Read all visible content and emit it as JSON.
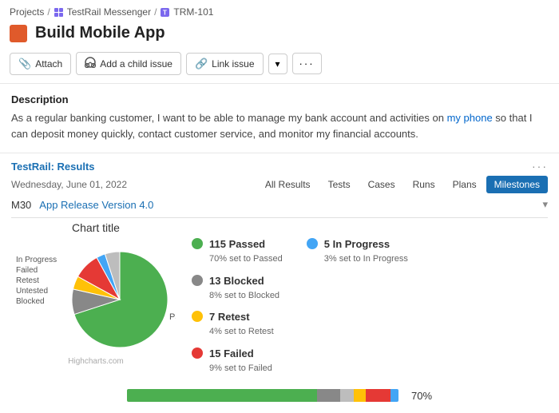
{
  "breadcrumb": {
    "projects": "Projects",
    "sep1": "/",
    "app": "TestRail Messenger",
    "sep2": "/",
    "issue": "TRM-101"
  },
  "header": {
    "title": "Build Mobile App"
  },
  "toolbar": {
    "attach_label": "Attach",
    "child_issue_label": "Add a child issue",
    "link_issue_label": "Link issue",
    "dropdown_label": "▾",
    "more_label": "···"
  },
  "description": {
    "title": "Description",
    "text_plain": "As a regular banking customer, I want to be able to manage my bank account and activities on ",
    "text_link": "my phone",
    "text_after": " so that I can deposit money quickly, contact customer service, and monitor my financial accounts."
  },
  "testrail": {
    "title": "TestRail: Results",
    "date": "Wednesday, June 01, 2022",
    "dots": "···",
    "tabs": [
      "All Results",
      "Tests",
      "Cases",
      "Runs",
      "Plans",
      "Milestones"
    ],
    "active_tab": "Milestones",
    "milestone": "M30",
    "milestone_link": "App Release Version 4.0"
  },
  "chart": {
    "title": "Chart title",
    "highcharts_label": "Highcharts.com",
    "labels": [
      "In Progress",
      "Failed",
      "Retest",
      "Untested",
      "Blocked",
      "Passed"
    ],
    "slices": [
      {
        "label": "Passed",
        "color": "#4caf50",
        "percent": 70
      },
      {
        "label": "Blocked",
        "color": "#888888",
        "percent": 8.5
      },
      {
        "label": "Retest",
        "color": "#ffc107",
        "percent": 4.5
      },
      {
        "label": "Failed",
        "color": "#e53935",
        "percent": 9
      },
      {
        "label": "In Progress",
        "color": "#42a5f5",
        "percent": 3
      },
      {
        "label": "Untested",
        "color": "#bdbdbd",
        "percent": 5
      }
    ]
  },
  "legend": [
    {
      "label": "Passed",
      "count": "115",
      "detail": "70% set to Passed",
      "color": "#4caf50"
    },
    {
      "label": "Blocked",
      "count": "13",
      "detail": "8% set to Blocked",
      "color": "#888888"
    },
    {
      "label": "Retest",
      "count": "7",
      "detail": "4% set to Retest",
      "color": "#ffc107"
    },
    {
      "label": "Failed",
      "count": "15",
      "detail": "9% set to Failed",
      "color": "#e53935"
    },
    {
      "label": "In Progress",
      "count": "5",
      "detail": "3% set to In Progress",
      "color": "#42a5f5"
    }
  ],
  "progress": {
    "percent_label": "70%",
    "segments": [
      {
        "color": "#4caf50",
        "width": 70
      },
      {
        "color": "#888888",
        "width": 8.5
      },
      {
        "color": "#bdbdbd",
        "width": 5
      },
      {
        "color": "#ffc107",
        "width": 4.5
      },
      {
        "color": "#e53935",
        "width": 9
      },
      {
        "color": "#42a5f5",
        "width": 3
      }
    ]
  }
}
